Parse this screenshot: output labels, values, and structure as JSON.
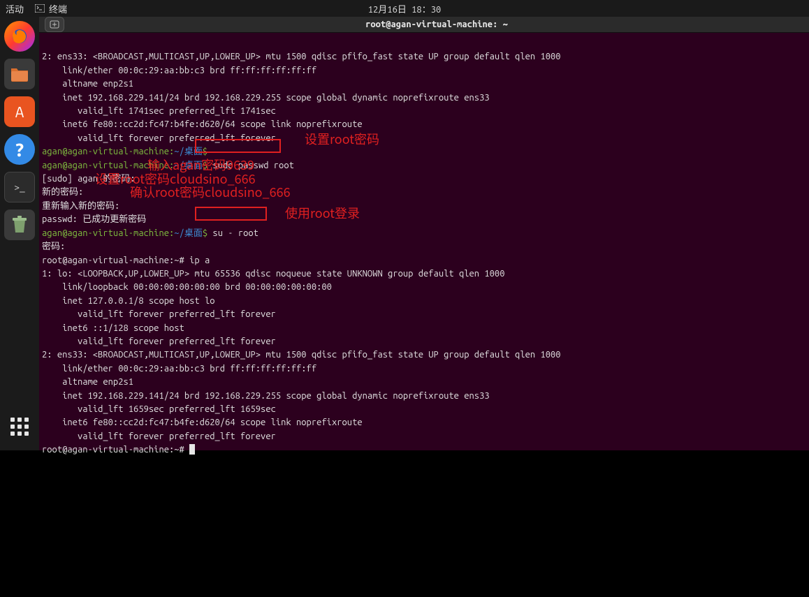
{
  "topbar": {
    "activities": "活动",
    "app_label": "终端",
    "datetime": "12月16日 18：30"
  },
  "window": {
    "title": "root@agan-virtual-machine: ~"
  },
  "prompt": {
    "user_host": "agan@agan-virtual-machine",
    "path": "~/桌面",
    "root_prompt": "root@agan-virtual-machine:~#"
  },
  "terminal_lines": {
    "l1": "2: ens33: <BROADCAST,MULTICAST,UP,LOWER_UP> mtu 1500 qdisc pfifo_fast state UP group default qlen 1000",
    "l2": "    link/ether 00:0c:29:aa:bb:c3 brd ff:ff:ff:ff:ff:ff",
    "l3": "    altname enp2s1",
    "l4": "    inet 192.168.229.141/24 brd 192.168.229.255 scope global dynamic noprefixroute ens33",
    "l5": "       valid_lft 1741sec preferred_lft 1741sec",
    "l6": "    inet6 fe80::cc2d:fc47:b4fe:d620/64 scope link noprefixroute",
    "l7": "       valid_lft forever preferred_lft forever",
    "cmd1": "sudo passwd root",
    "l8": "[sudo] agan 的密码:",
    "l9": "新的密码:",
    "l10": "重新输入新的密码:",
    "l11": "passwd: 已成功更新密码",
    "cmd2": "su - root",
    "l12": "密码:",
    "l13": "ip a",
    "l14": "1: lo: <LOOPBACK,UP,LOWER_UP> mtu 65536 qdisc noqueue state UNKNOWN group default qlen 1000",
    "l15": "    link/loopback 00:00:00:00:00:00 brd 00:00:00:00:00:00",
    "l16": "    inet 127.0.0.1/8 scope host lo",
    "l17": "       valid_lft forever preferred_lft forever",
    "l18": "    inet6 ::1/128 scope host",
    "l19": "       valid_lft forever preferred_lft forever",
    "l20": "2: ens33: <BROADCAST,MULTICAST,UP,LOWER_UP> mtu 1500 qdisc pfifo_fast state UP group default qlen 1000",
    "l21": "    link/ether 00:0c:29:aa:bb:c3 brd ff:ff:ff:ff:ff:ff",
    "l22": "    altname enp2s1",
    "l23": "    inet 192.168.229.141/24 brd 192.168.229.255 scope global dynamic noprefixroute ens33",
    "l24": "       valid_lft 1659sec preferred_lft 1659sec",
    "l25": "    inet6 fe80::cc2d:fc47:b4fe:d620/64 scope link noprefixroute",
    "l26": "       valid_lft forever preferred_lft forever"
  },
  "annotations": {
    "a1": "设置root密码",
    "a2": "输入agan密码9639",
    "a3": "设置root密码cloudsino_666",
    "a4": "确认root密码cloudsino_666",
    "a5": "使用root登录"
  },
  "icons": {
    "terminal_glyph": ">_",
    "help_glyph": "?",
    "software_glyph": "A"
  }
}
